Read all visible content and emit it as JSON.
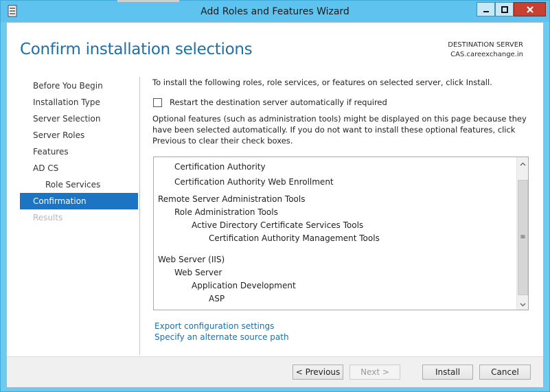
{
  "window": {
    "title": "Add Roles and Features Wizard",
    "icons": {
      "app": "server-manager-icon",
      "minimize": "minimize-icon",
      "maximize": "maximize-icon",
      "close": "close-icon"
    }
  },
  "header": {
    "page_title": "Confirm installation selections",
    "destination_label": "DESTINATION SERVER",
    "destination_server": "CAS.careexchange.in"
  },
  "nav": {
    "items": [
      {
        "label": "Before You Begin",
        "state": "normal"
      },
      {
        "label": "Installation Type",
        "state": "normal"
      },
      {
        "label": "Server Selection",
        "state": "normal"
      },
      {
        "label": "Server Roles",
        "state": "normal"
      },
      {
        "label": "Features",
        "state": "normal"
      },
      {
        "label": "AD CS",
        "state": "normal"
      },
      {
        "label": "Role Services",
        "state": "sub"
      },
      {
        "label": "Confirmation",
        "state": "active"
      },
      {
        "label": "Results",
        "state": "disabled"
      }
    ]
  },
  "main": {
    "intro": "To install the following roles, role services, or features on selected server, click Install.",
    "restart_label": "Restart the destination server automatically if required",
    "restart_checked": false,
    "optional_text": "Optional features (such as administration tools) might be displayed on this page because they have been selected automatically. If you do not want to install these optional features, click Previous to clear their check boxes.",
    "selections": [
      {
        "text": "Certification Authority",
        "level": 1
      },
      {
        "text": "Certification Authority Web Enrollment",
        "level": 1
      },
      {
        "text": "Remote Server Administration Tools",
        "level": 0
      },
      {
        "text": "Role Administration Tools",
        "level": 1
      },
      {
        "text": "Active Directory Certificate Services Tools",
        "level": 2
      },
      {
        "text": "Certification Authority Management Tools",
        "level": 3
      },
      {
        "text": "Web Server (IIS)",
        "level": 0
      },
      {
        "text": "Web Server",
        "level": 1
      },
      {
        "text": "Application Development",
        "level": 2
      },
      {
        "text": "ASP",
        "level": 3
      }
    ],
    "export_link": "Export configuration settings",
    "alternate_link": "Specify an alternate source path"
  },
  "footer": {
    "previous": "< Previous",
    "next": "Next >",
    "install": "Install",
    "cancel": "Cancel"
  },
  "colors": {
    "title_bar": "#5ec3ef",
    "accent": "#1c74c3",
    "page_title": "#1f6fa8",
    "close_button": "#c84031"
  }
}
